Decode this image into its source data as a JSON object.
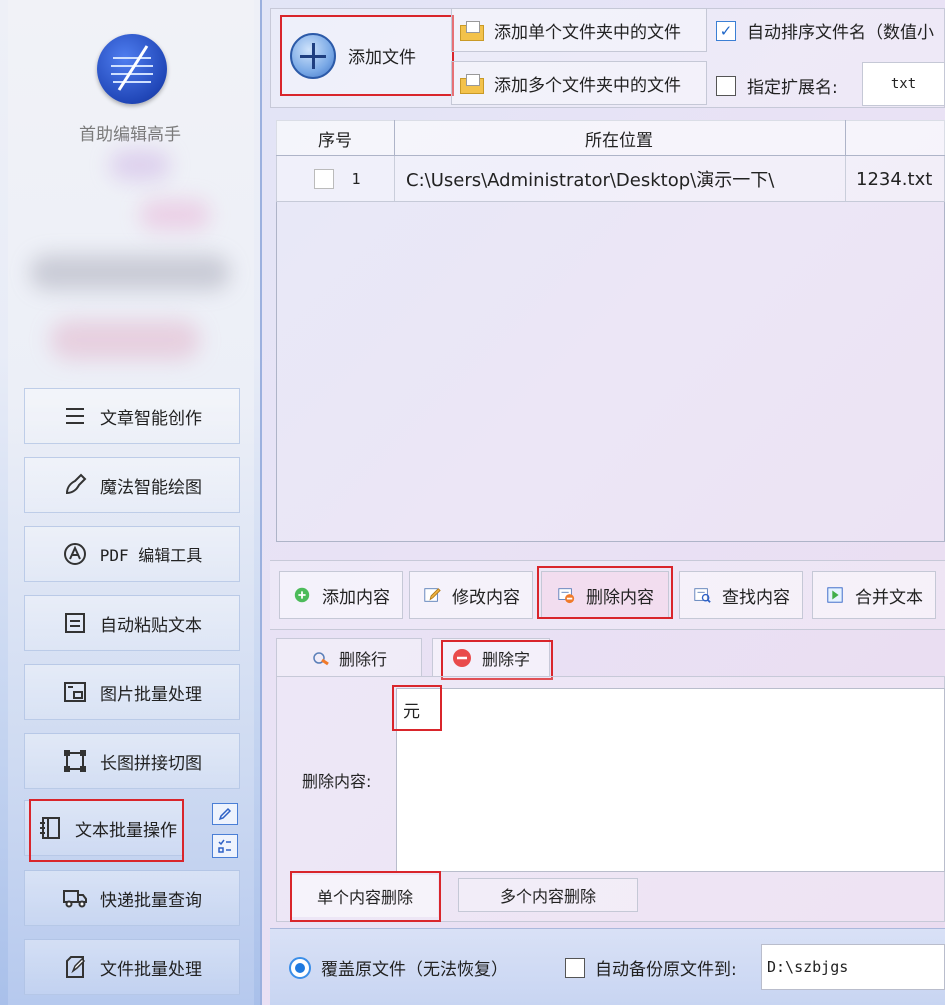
{
  "app": {
    "name": "首助编辑高手"
  },
  "sidebar": {
    "items": [
      {
        "label": "文章智能创作",
        "icon": "list-icon"
      },
      {
        "label": "魔法智能绘图",
        "icon": "brush-icon"
      },
      {
        "label": "PDF 编辑工具",
        "icon": "pdf-icon"
      },
      {
        "label": "自动粘贴文本",
        "icon": "paste-icon"
      },
      {
        "label": "图片批量处理",
        "icon": "image-icon"
      },
      {
        "label": "长图拼接切图",
        "icon": "crop-icon"
      },
      {
        "label": "文本批量操作",
        "icon": "notebook-icon"
      },
      {
        "label": "快递批量查询",
        "icon": "truck-icon"
      },
      {
        "label": "文件批量处理",
        "icon": "file-edit-icon"
      }
    ]
  },
  "toolbar": {
    "add_file_label": "添加文件",
    "add_single_folder_label": "添加单个文件夹中的文件",
    "add_multi_folder_label": "添加多个文件夹中的文件",
    "auto_sort_label": "自动排序文件名（数值小",
    "auto_sort_checked": true,
    "ext_label": "指定扩展名:",
    "ext_checked": false,
    "ext_value": "txt"
  },
  "table": {
    "headers": [
      "序号",
      "所在位置"
    ],
    "rows": [
      {
        "index": "1",
        "location": "C:\\Users\\Administrator\\Desktop\\演示一下\\",
        "name": "1234.txt"
      }
    ]
  },
  "content_tools": {
    "add": "添加内容",
    "modify": "修改内容",
    "delete": "删除内容",
    "find": "查找内容",
    "merge": "合并文本"
  },
  "delete_tabs": {
    "delete_line": "删除行",
    "delete_char": "删除字"
  },
  "delete_panel": {
    "label": "删除内容:",
    "value": "元",
    "subtab_single": "单个内容删除",
    "subtab_multi": "多个内容删除"
  },
  "bottom": {
    "overwrite_label": "覆盖原文件（无法恢复）",
    "backup_label": "自动备份原文件到:",
    "backup_path": "D:\\szbjgs"
  }
}
